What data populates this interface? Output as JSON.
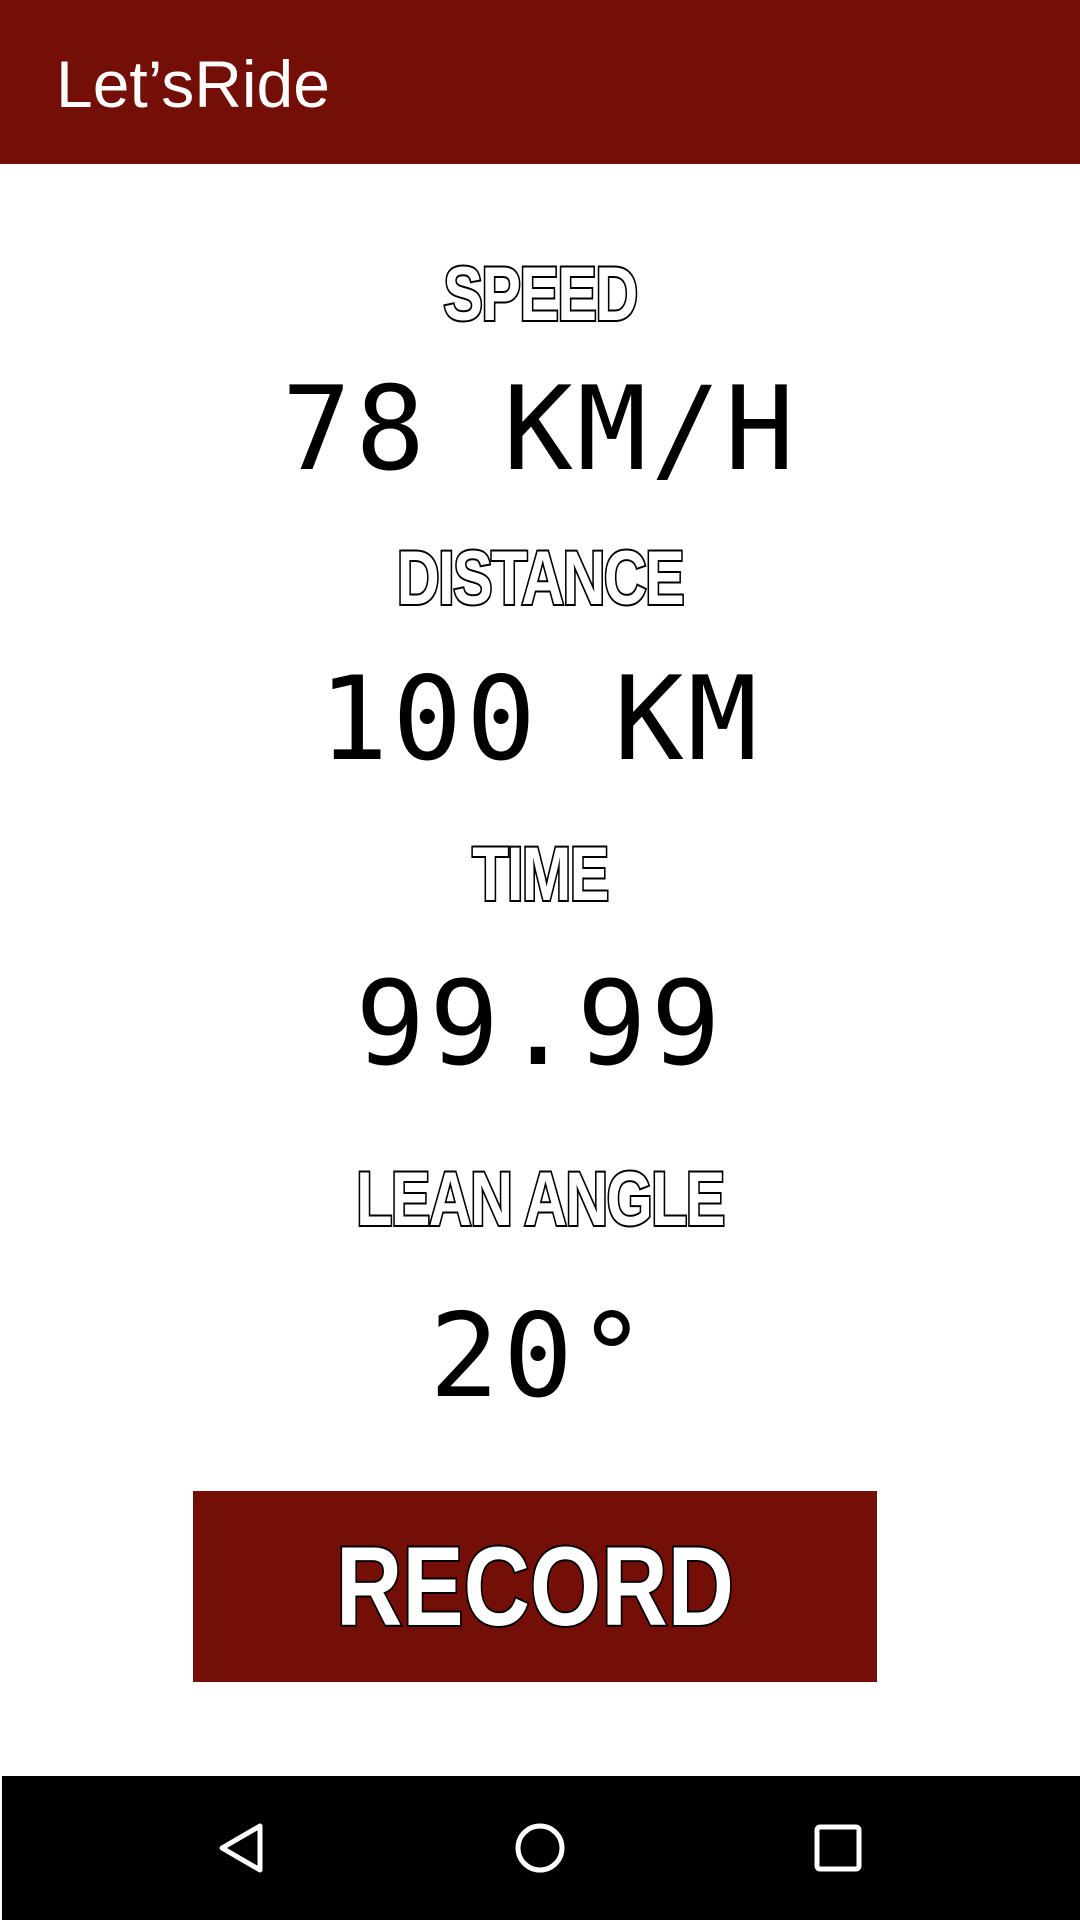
{
  "app_bar": {
    "title": "Let’sRide"
  },
  "metrics": {
    "speed": {
      "label": "SPEED",
      "value": "78 KM/H"
    },
    "distance": {
      "label": "DISTANCE",
      "value": "100 KM"
    },
    "time": {
      "label": "TIME",
      "value": "99.99"
    },
    "lean_angle": {
      "label": "LEAN ANGLE",
      "value": "20°"
    }
  },
  "record_button": {
    "label": "RECORD"
  },
  "nav_bar": {
    "back_icon": "back-triangle-icon",
    "home_icon": "home-circle-icon",
    "recents_icon": "recents-square-icon"
  },
  "colors": {
    "primary": "#730f06",
    "nav_background": "#000000",
    "background": "#ffffff"
  }
}
